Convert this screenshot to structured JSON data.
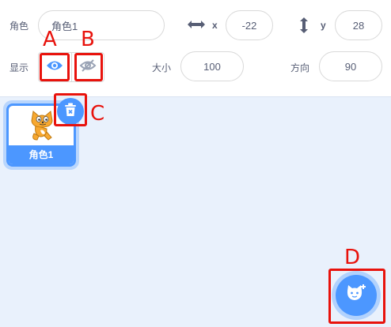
{
  "sprite_info": {
    "sprite_label": "角色",
    "sprite_name": "角色1",
    "x_label": "x",
    "x_value": "-22",
    "y_label": "y",
    "y_value": "28",
    "show_label": "显示",
    "size_label": "大小",
    "size_value": "100",
    "direction_label": "方向",
    "direction_value": "90"
  },
  "sprite_list": {
    "sprites": [
      {
        "name": "角色1"
      }
    ]
  },
  "callouts": {
    "a": "A",
    "b": "B",
    "c": "C",
    "d": "D"
  },
  "colors": {
    "accent": "#4c97ff",
    "callout": "#e8120c",
    "panel_bg": "#e9f1fc",
    "text": "#575e75"
  },
  "icons": [
    "show-eye-icon",
    "hide-eye-icon",
    "trash-icon",
    "x-arrows-icon",
    "y-arrows-icon",
    "sprite-cat-icon",
    "choose-sprite-cat-icon"
  ]
}
